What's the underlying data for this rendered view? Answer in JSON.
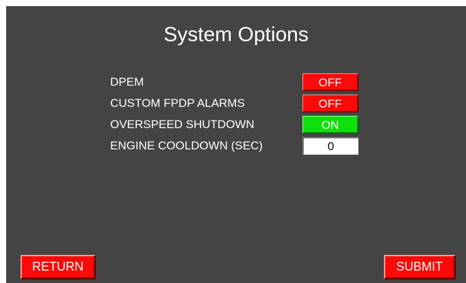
{
  "title": "System Options",
  "options": [
    {
      "label": "DPEM",
      "value": "OFF",
      "state": "off"
    },
    {
      "label": "CUSTOM FPDP ALARMS",
      "value": "OFF",
      "state": "off"
    },
    {
      "label": "OVERSPEED SHUTDOWN",
      "value": "ON",
      "state": "on"
    }
  ],
  "cooldown": {
    "label": "ENGINE COOLDOWN (SEC)",
    "value": "0"
  },
  "buttons": {
    "return": "RETURN",
    "submit": "SUBMIT"
  },
  "colors": {
    "background": "#454444",
    "off": "#fb0a0a",
    "on": "#0de00a",
    "button": "#fb0a0a"
  }
}
